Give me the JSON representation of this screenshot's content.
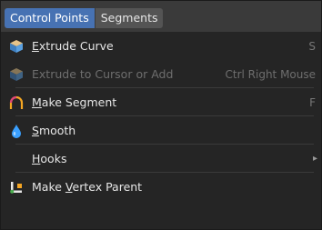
{
  "tabs": {
    "control_points": "Control Points",
    "segments": "Segments"
  },
  "items": {
    "extrude_curve": {
      "first": "E",
      "rest": "xtrude Curve",
      "shortcut": "S",
      "icon": "extrude-icon"
    },
    "extrude_cursor": {
      "label": "Extrude to Cursor or Add",
      "shortcut": "Ctrl Right Mouse",
      "icon": "extrude-icon"
    },
    "make_segment": {
      "first": "M",
      "rest": "ake Segment",
      "shortcut": "F",
      "icon": "curve-arc-icon"
    },
    "smooth": {
      "first": "S",
      "rest": "mooth",
      "icon": "droplet-icon"
    },
    "hooks": {
      "first": "H",
      "rest": "ooks",
      "arrow": "▸"
    },
    "make_vertex_parent": {
      "pre": "Make ",
      "accent": "V",
      "post": "ertex Parent",
      "icon": "vertex-parent-icon"
    }
  },
  "colors": {
    "active_tab": "#4772b3",
    "menu_bg": "#252525",
    "extrude_icon_top": "#e6c48a",
    "extrude_icon_body": "#4a8fcf",
    "arc_color": "#f5a623",
    "droplet_color": "#3aa0ff"
  }
}
